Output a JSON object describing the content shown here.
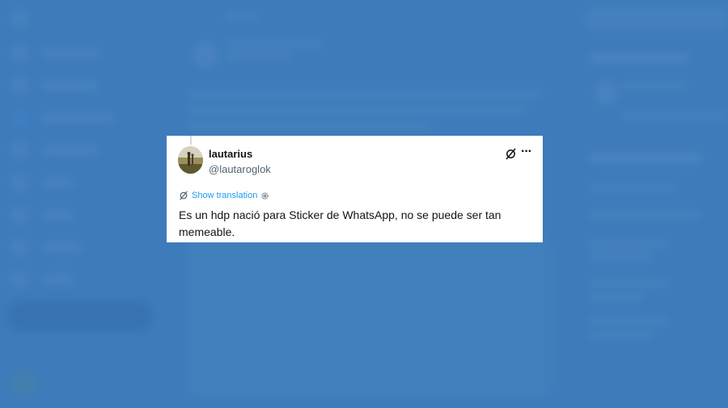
{
  "tweet": {
    "display_name": "lautarius",
    "handle": "@lautaroglok",
    "show_translation": "Show translation",
    "text": "Es un hdp nació para Sticker de WhatsApp, no se puede ser tan memeable.",
    "more_label": "···"
  },
  "colors": {
    "background_blue": "#4a84bf",
    "link_blue": "#1d9bf0",
    "text_primary": "#0f1419",
    "text_secondary": "#536471"
  },
  "icons": [
    "grok-icon",
    "more-icon",
    "translate-icon",
    "settings-icon",
    "avatar"
  ]
}
